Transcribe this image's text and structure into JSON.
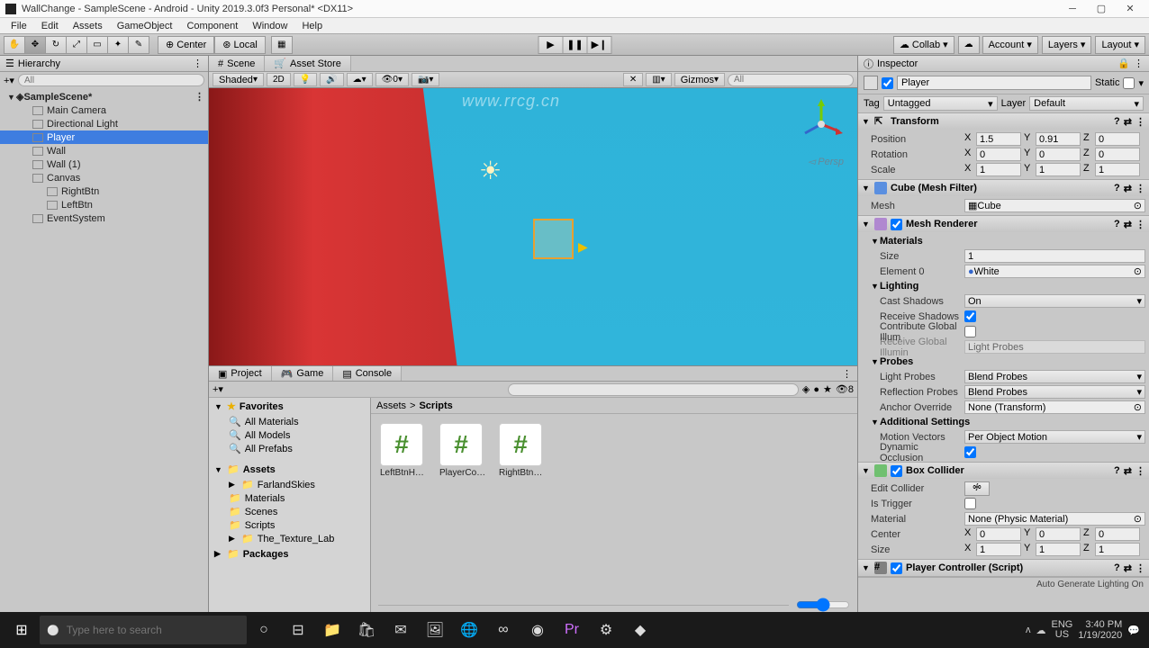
{
  "title": "WallChange - SampleScene - Android - Unity 2019.3.0f3 Personal* <DX11>",
  "menu": [
    "File",
    "Edit",
    "Assets",
    "GameObject",
    "Component",
    "Window",
    "Help"
  ],
  "toolbar": {
    "pivot_center": "Center",
    "pivot_local": "Local",
    "collab": "Collab",
    "account": "Account",
    "layers": "Layers",
    "layout": "Layout"
  },
  "hierarchy": {
    "tab": "Hierarchy",
    "search_placeholder": "All",
    "scene": "SampleScene*",
    "items": [
      {
        "name": "Main Camera",
        "level": 1,
        "sel": false
      },
      {
        "name": "Directional Light",
        "level": 1,
        "sel": false
      },
      {
        "name": "Player",
        "level": 1,
        "sel": true
      },
      {
        "name": "Wall",
        "level": 1,
        "sel": false
      },
      {
        "name": "Wall (1)",
        "level": 1,
        "sel": false
      },
      {
        "name": "Canvas",
        "level": 1,
        "sel": false
      },
      {
        "name": "RightBtn",
        "level": 2,
        "sel": false
      },
      {
        "name": "LeftBtn",
        "level": 2,
        "sel": false
      },
      {
        "name": "EventSystem",
        "level": 1,
        "sel": false
      }
    ]
  },
  "scene": {
    "tab_scene": "Scene",
    "tab_asset": "Asset Store",
    "shaded": "Shaded",
    "mode2d": "2D",
    "gizmos": "Gizmos",
    "persp": "Persp",
    "search_placeholder": "All"
  },
  "project": {
    "tab_project": "Project",
    "tab_game": "Game",
    "tab_console": "Console",
    "favorites": "Favorites",
    "fav_items": [
      "All Materials",
      "All Models",
      "All Prefabs"
    ],
    "assets_root": "Assets",
    "folders": [
      "FarlandSkies",
      "Materials",
      "Scenes",
      "Scripts",
      "The_Texture_Lab"
    ],
    "packages": "Packages",
    "breadcrumb_assets": "Assets",
    "breadcrumb_sep": ">",
    "breadcrumb_current": "Scripts",
    "files": [
      "LeftBtnHa...",
      "PlayerCont...",
      "RightBtnH..."
    ],
    "count": "8"
  },
  "inspector": {
    "tab": "Inspector",
    "name": "Player",
    "static": "Static",
    "tag_label": "Tag",
    "tag_value": "Untagged",
    "layer_label": "Layer",
    "layer_value": "Default",
    "transform": {
      "title": "Transform",
      "position": "Position",
      "rotation": "Rotation",
      "scale": "Scale",
      "pos": {
        "x": "1.5",
        "y": "0.91",
        "z": "0"
      },
      "rot": {
        "x": "0",
        "y": "0",
        "z": "0"
      },
      "scl": {
        "x": "1",
        "y": "1",
        "z": "1"
      }
    },
    "meshfilter": {
      "title": "Cube (Mesh Filter)",
      "mesh_label": "Mesh",
      "mesh_value": "Cube"
    },
    "meshrenderer": {
      "title": "Mesh Renderer",
      "materials": "Materials",
      "size_label": "Size",
      "size_value": "1",
      "elem0_label": "Element 0",
      "elem0_value": "White",
      "lighting": "Lighting",
      "cast_shadows_label": "Cast Shadows",
      "cast_shadows_value": "On",
      "receive_shadows": "Receive Shadows",
      "contribute_gi": "Contribute Global Illum",
      "receive_gi_label": "Receive Global Illumin",
      "receive_gi_value": "Light Probes",
      "probes": "Probes",
      "light_probes_label": "Light Probes",
      "light_probes_value": "Blend Probes",
      "reflection_probes_label": "Reflection Probes",
      "reflection_probes_value": "Blend Probes",
      "anchor_override_label": "Anchor Override",
      "anchor_override_value": "None (Transform)",
      "additional": "Additional Settings",
      "motion_vectors_label": "Motion Vectors",
      "motion_vectors_value": "Per Object Motion",
      "dynamic_occlusion": "Dynamic Occlusion"
    },
    "boxcollider": {
      "title": "Box Collider",
      "edit_collider": "Edit Collider",
      "is_trigger": "Is Trigger",
      "material_label": "Material",
      "material_value": "None (Physic Material)",
      "center_label": "Center",
      "center": {
        "x": "0",
        "y": "0",
        "z": "0"
      },
      "size_label": "Size",
      "size": {
        "x": "1",
        "y": "1",
        "z": "1"
      }
    },
    "playercontroller": {
      "title": "Player Controller (Script)"
    },
    "lighting_footer": "Auto Generate Lighting On"
  },
  "taskbar": {
    "search_placeholder": "Type here to search",
    "lang": "ENG",
    "kb": "US",
    "time": "3:40 PM",
    "date": "1/19/2020"
  },
  "watermark_url": "www.rrcg.cn"
}
